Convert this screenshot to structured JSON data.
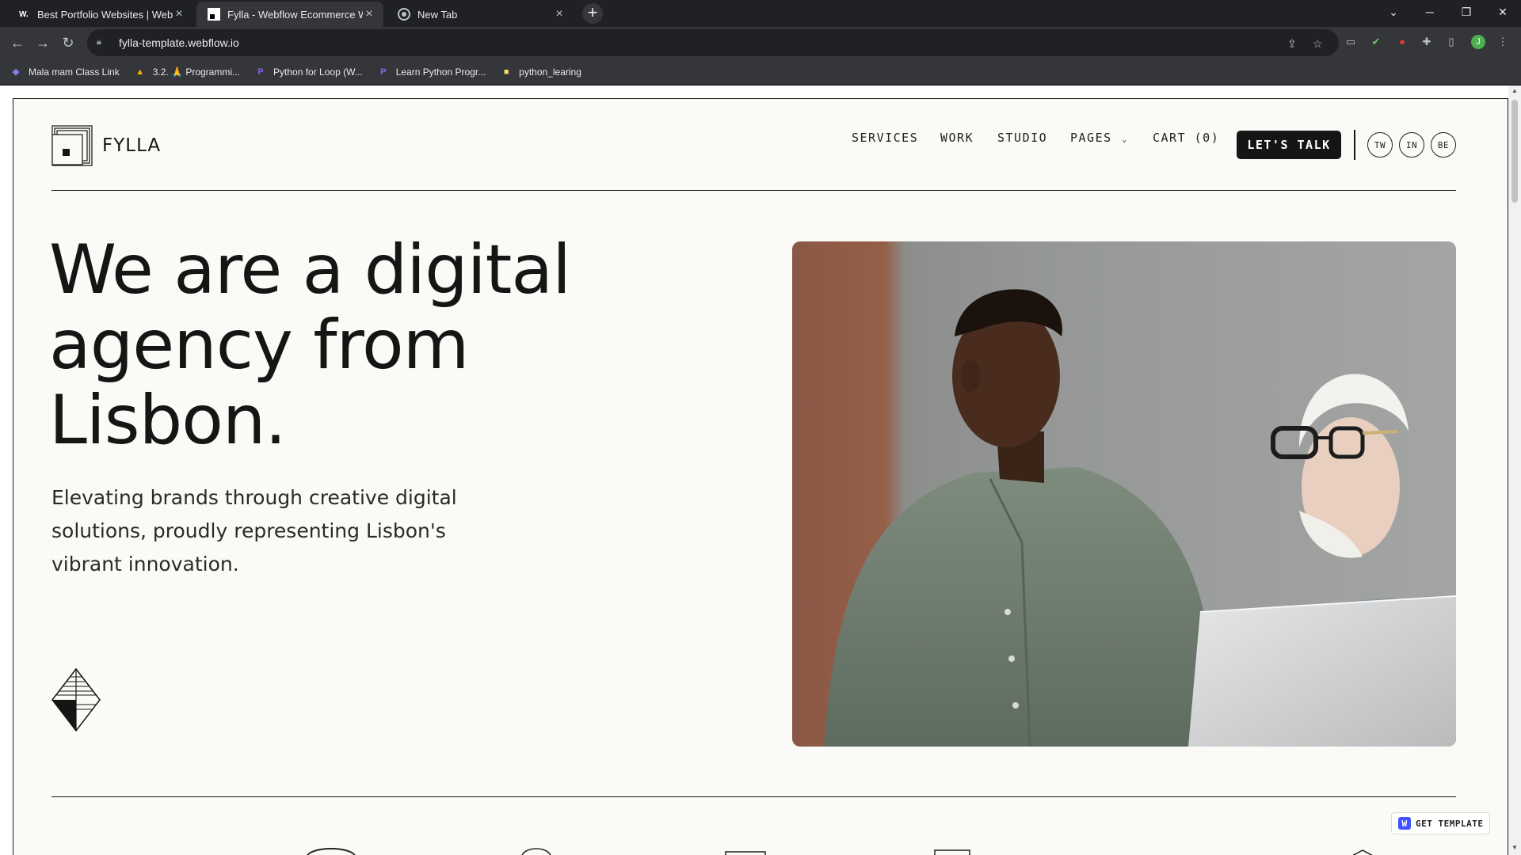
{
  "browser": {
    "tabs": [
      {
        "favicon": "W.",
        "title": "Best Portfolio Websites | Web De"
      },
      {
        "favicon": "",
        "title": "Fylla - Webflow Ecommerce Web"
      },
      {
        "favicon": "",
        "title": "New Tab"
      }
    ],
    "url": "fylla-template.webflow.io",
    "bookmarks": [
      {
        "label": "Mala mam Class Link",
        "icon": "teams-icon"
      },
      {
        "label": "3.2. 🙏 Programmi...",
        "icon": "triangle-icon"
      },
      {
        "label": "Python for Loop (W...",
        "icon": "p-icon"
      },
      {
        "label": "Learn Python Progr...",
        "icon": "p-icon"
      },
      {
        "label": "python_learing",
        "icon": "folder-icon"
      }
    ]
  },
  "site": {
    "logo_text": "FYLLA",
    "nav": {
      "services": "SERVICES",
      "work": "WORK",
      "studio": "STUDIO",
      "pages": "PAGES",
      "cart": "CART (0)"
    },
    "cta": "LET'S TALK",
    "social": [
      "TW",
      "IN",
      "BE"
    ],
    "hero": {
      "headline_1": "We are a digital",
      "headline_2": "agency from",
      "headline_3": "Lisbon.",
      "subtext": "Elevating brands through creative digital solutions, proudly representing Lisbon's vibrant innovation."
    },
    "badge": "GET TEMPLATE"
  },
  "colors": {
    "page_bg": "#fbfaf6",
    "ink": "#151515",
    "webflow_blue": "#4353ff"
  }
}
